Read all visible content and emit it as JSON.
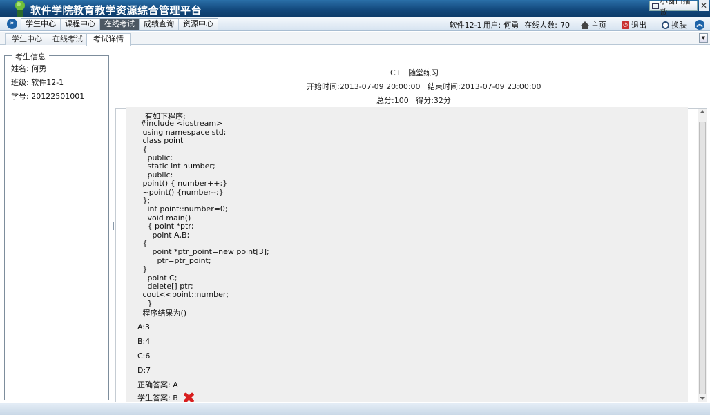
{
  "titlebar": {
    "title": "软件学院教育教学资源综合管理平台",
    "mini_window_label": "小窗口播放",
    "close_glyph": "✕"
  },
  "nav": {
    "expand_glyph": "»",
    "items": [
      "学生中心",
      "课程中心",
      "在线考试",
      "成绩查询",
      "资源中心"
    ],
    "active_index": 2,
    "user_class": "软件12-1",
    "user_label": "用户:",
    "user_name": "何勇",
    "online_label": "在线人数:",
    "online_count": "70",
    "home_label": "主页",
    "exit_label": "退出",
    "skin_label": "换肤"
  },
  "tabs": [
    "学生中心",
    "在线考试",
    "考试详情"
  ],
  "active_tab": 2,
  "student_info": {
    "legend": "考生信息",
    "name": "姓名: 何勇",
    "class": "班级: 软件12-1",
    "id": "学号: 20122501001"
  },
  "exam": {
    "title": "C++随堂练习",
    "time": "开始时间:2013-07-09 20:00:00   结束时间:2013-07-09 23:00:00",
    "score": "总分:100   得分:32分"
  },
  "question": {
    "code_lines": [
      "    有如下程序:",
      "  #include <iostream>",
      "   using namespace std;",
      "   class point",
      "   {",
      "     public:",
      "     static int number;",
      "     public:",
      "   point() { number++;}",
      "   ~point() {number--;}",
      "   };",
      "     int point::number=0;",
      "     void main()",
      "     { point *ptr;",
      "       point A,B;",
      "   {",
      "       point *ptr_point=new point[3];",
      "         ptr=ptr_point;",
      "   }",
      "     point C;",
      "     delete[] ptr;",
      "   cout<<point::number;",
      "     }",
      "   程序结果为()"
    ],
    "options": [
      "A:3",
      "B:4",
      "C:6",
      "D:7"
    ],
    "correct_answer": "正确答案: A",
    "student_answer": "学生答案: B"
  }
}
